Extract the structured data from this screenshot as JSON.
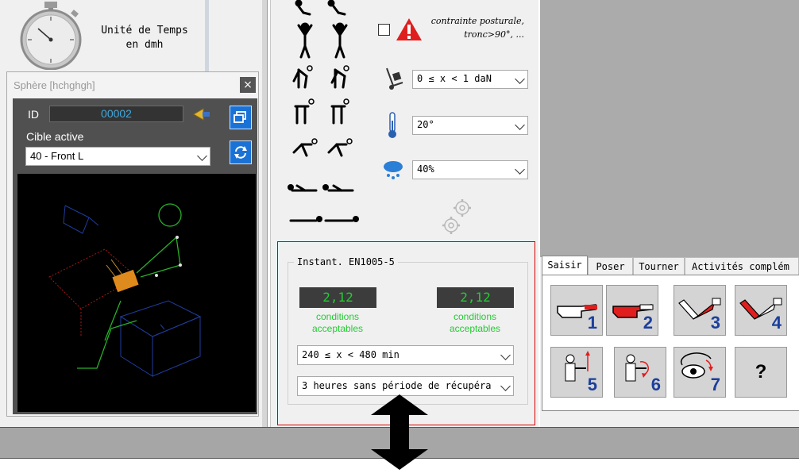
{
  "time_unit": {
    "line1": "Unité de Temps",
    "line2": "en dmh"
  },
  "sphere": {
    "title": "Sphère [hchghgh]",
    "close_label": "×",
    "id_label": "ID",
    "id_value": "00002",
    "cible_label": "Cible active",
    "cible_value": "40 - Front L"
  },
  "posture": {
    "constraint_line1": "contrainte posturale,",
    "constraint_line2": "tronc>90°, ...",
    "weight_value": "0 ≤ x < 1 daN",
    "temperature_value": "20°",
    "humidity_value": "40%"
  },
  "en1005": {
    "legend": "Instant. EN1005-5",
    "value_left": "2,12",
    "value_right": "2,12",
    "cond_line1": "conditions",
    "cond_line2": "acceptables",
    "duration_value": "240 ≤ x < 480 min",
    "recovery_value": "3 heures sans période de récupéra"
  },
  "tabs": [
    {
      "label": "Saisir"
    },
    {
      "label": "Poser"
    },
    {
      "label": "Tourner"
    },
    {
      "label": "Activités complém"
    }
  ],
  "tools": [
    {
      "num": "1"
    },
    {
      "num": "2"
    },
    {
      "num": "3"
    },
    {
      "num": "4"
    },
    {
      "num": "5"
    },
    {
      "num": "6"
    },
    {
      "num": "7"
    },
    {
      "num": "?"
    }
  ],
  "colors": {
    "accent_blue": "#1c3f9c",
    "ok_green": "#22cc33",
    "alert_red": "#e01e1e",
    "panel_dark": "#505050"
  }
}
